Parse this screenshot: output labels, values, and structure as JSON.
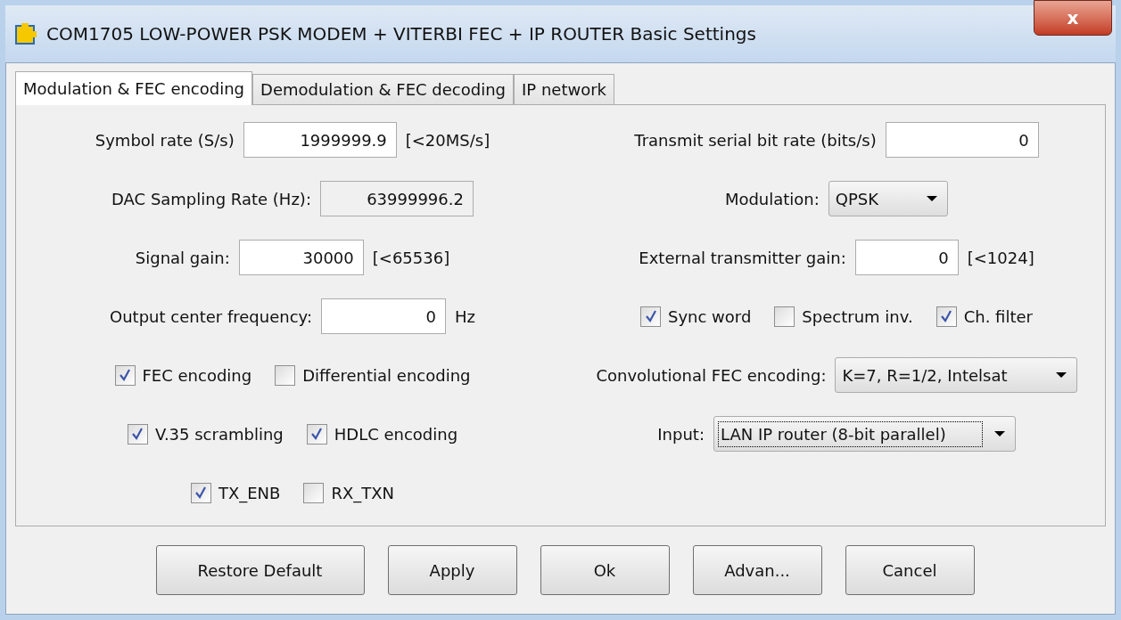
{
  "window": {
    "title": "COM1705 LOW-POWER PSK MODEM + VITERBI FEC + IP ROUTER Basic Settings",
    "close": "x"
  },
  "tabs": [
    {
      "label": "Modulation & FEC encoding",
      "selected": true
    },
    {
      "label": "Demodulation & FEC decoding",
      "selected": false
    },
    {
      "label": "IP network",
      "selected": false
    }
  ],
  "left_rows": [
    {
      "kind": "field",
      "label": "Symbol rate (S/s)",
      "value": "1999999.9",
      "suffix": "[<20MS/s]",
      "readonly": false
    },
    {
      "kind": "field",
      "label": "DAC Sampling Rate (Hz):",
      "value": "63999996.2",
      "readonly": true
    },
    {
      "kind": "field",
      "label": "Signal gain:",
      "value": "30000",
      "suffix": "[<65536]",
      "readonly": false
    },
    {
      "kind": "field",
      "label": "Output center frequency:",
      "value": "0",
      "suffix": "Hz",
      "readonly": false
    },
    {
      "kind": "checks",
      "items": [
        {
          "label": "FEC encoding",
          "checked": true
        },
        {
          "label": "Differential encoding",
          "checked": false
        }
      ]
    },
    {
      "kind": "checks",
      "items": [
        {
          "label": "V.35 scrambling",
          "checked": true
        },
        {
          "label": "HDLC encoding",
          "checked": true
        }
      ]
    },
    {
      "kind": "checks",
      "items": [
        {
          "label": "TX_ENB",
          "checked": true
        },
        {
          "label": "RX_TXN",
          "checked": false
        }
      ]
    }
  ],
  "right_rows": [
    {
      "kind": "field",
      "label": "Transmit serial bit rate (bits/s)",
      "value": "0",
      "readonly": false
    },
    {
      "kind": "dropdown",
      "label": "Modulation:",
      "value": "QPSK",
      "focused": false
    },
    {
      "kind": "field",
      "label": "External transmitter gain:",
      "value": "0",
      "suffix": "[<1024]",
      "readonly": false
    },
    {
      "kind": "checks",
      "items": [
        {
          "label": "Sync word",
          "checked": true
        },
        {
          "label": "Spectrum inv.",
          "checked": false
        },
        {
          "label": "Ch. filter",
          "checked": true
        }
      ]
    },
    {
      "kind": "dropdown",
      "label": "Convolutional FEC encoding:",
      "value": "K=7, R=1/2, Intelsat",
      "focused": false
    },
    {
      "kind": "dropdown",
      "label": "Input:",
      "value": "LAN IP router (8-bit parallel)",
      "focused": true
    }
  ],
  "buttons": [
    "Restore Default",
    "Apply",
    "Ok",
    "Advan...",
    "Cancel"
  ]
}
